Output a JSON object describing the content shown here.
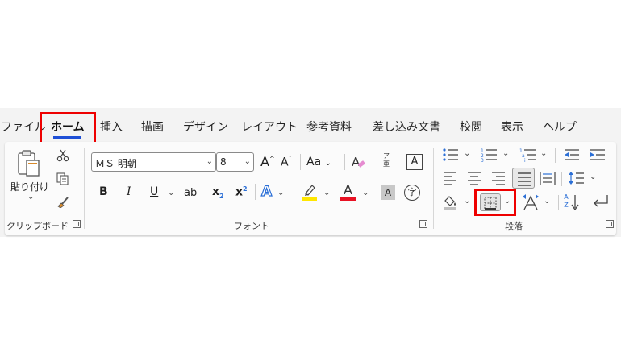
{
  "tabs": [
    "ファイル",
    "ホーム",
    "挿入",
    "描画",
    "デザイン",
    "レイアウト",
    "参考資料",
    "差し込み文書",
    "校閲",
    "表示",
    "ヘルプ"
  ],
  "active_tab": "ホーム",
  "clipboard": {
    "paste_label": "貼り付け",
    "dropdown_glyph": "⌄",
    "group_label": "クリップボード"
  },
  "font": {
    "font_name": "ＭＳ 明朝",
    "font_size": "8",
    "grow_label": "A",
    "shrink_label": "A",
    "change_case_label": "Aa",
    "bold": "B",
    "italic": "I",
    "underline": "U",
    "strikethrough": "ab",
    "subscript": "x",
    "subscript_mark": "2",
    "superscript": "x",
    "superscript_mark": "2",
    "text_effects": "A",
    "font_color_label": "A",
    "char_shading_label": "A",
    "phonetic_top": "ア",
    "phonetic_bottom": "亜",
    "char_border_label": "A",
    "enclose_char_label": "字",
    "group_label": "フォント",
    "colors": {
      "highlight": "#ffe600",
      "font_color": "#e81123",
      "effects": "#2b6fd6"
    }
  },
  "paragraph": {
    "group_label": "段落",
    "sort_label": "A Z",
    "icons": [
      "bullets-icon",
      "numbering-icon",
      "multilevel-list-icon",
      "decrease-indent-icon",
      "increase-indent-icon",
      "align-left-icon",
      "center-icon",
      "align-right-icon",
      "justify-icon",
      "distributed-icon",
      "line-spacing-icon",
      "shading-icon",
      "borders-icon",
      "asian-layout-icon",
      "sort-icon",
      "paragraph-mark-icon"
    ]
  },
  "highlight_color": "#ee0000"
}
